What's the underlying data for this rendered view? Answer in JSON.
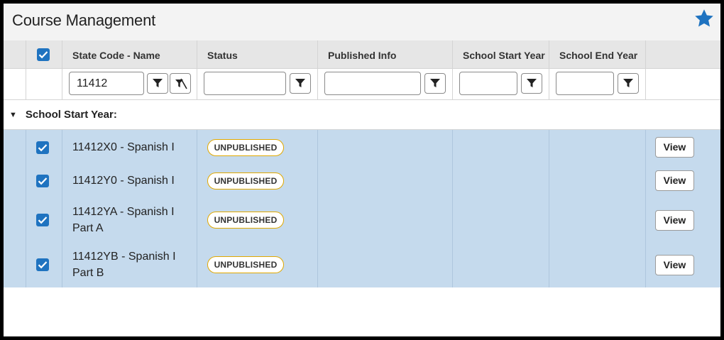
{
  "title": "Course Management",
  "accent_color": "#1f73c0",
  "favorite_icon": "star-icon",
  "columns": {
    "state_code_name": "State Code - Name",
    "status": "Status",
    "published_info": "Published Info",
    "school_start_year": "School Start Year",
    "school_end_year": "School End Year"
  },
  "filters": {
    "state_code_name": "11412",
    "status": "",
    "published_info": "",
    "school_start_year": "",
    "school_end_year": ""
  },
  "group": {
    "label": "School Start Year:"
  },
  "rows": [
    {
      "name_line1": "11412X0 - Spanish I",
      "name_line2": "",
      "status": "UNPUBLISHED",
      "action": "View",
      "checked": true
    },
    {
      "name_line1": "11412Y0 - Spanish I",
      "name_line2": "",
      "status": "UNPUBLISHED",
      "action": "View",
      "checked": true
    },
    {
      "name_line1": "11412YA - Spanish I",
      "name_line2": "Part A",
      "status": "UNPUBLISHED",
      "action": "View",
      "checked": true
    },
    {
      "name_line1": "11412YB - Spanish I",
      "name_line2": "Part B",
      "status": "UNPUBLISHED",
      "action": "View",
      "checked": true
    }
  ]
}
